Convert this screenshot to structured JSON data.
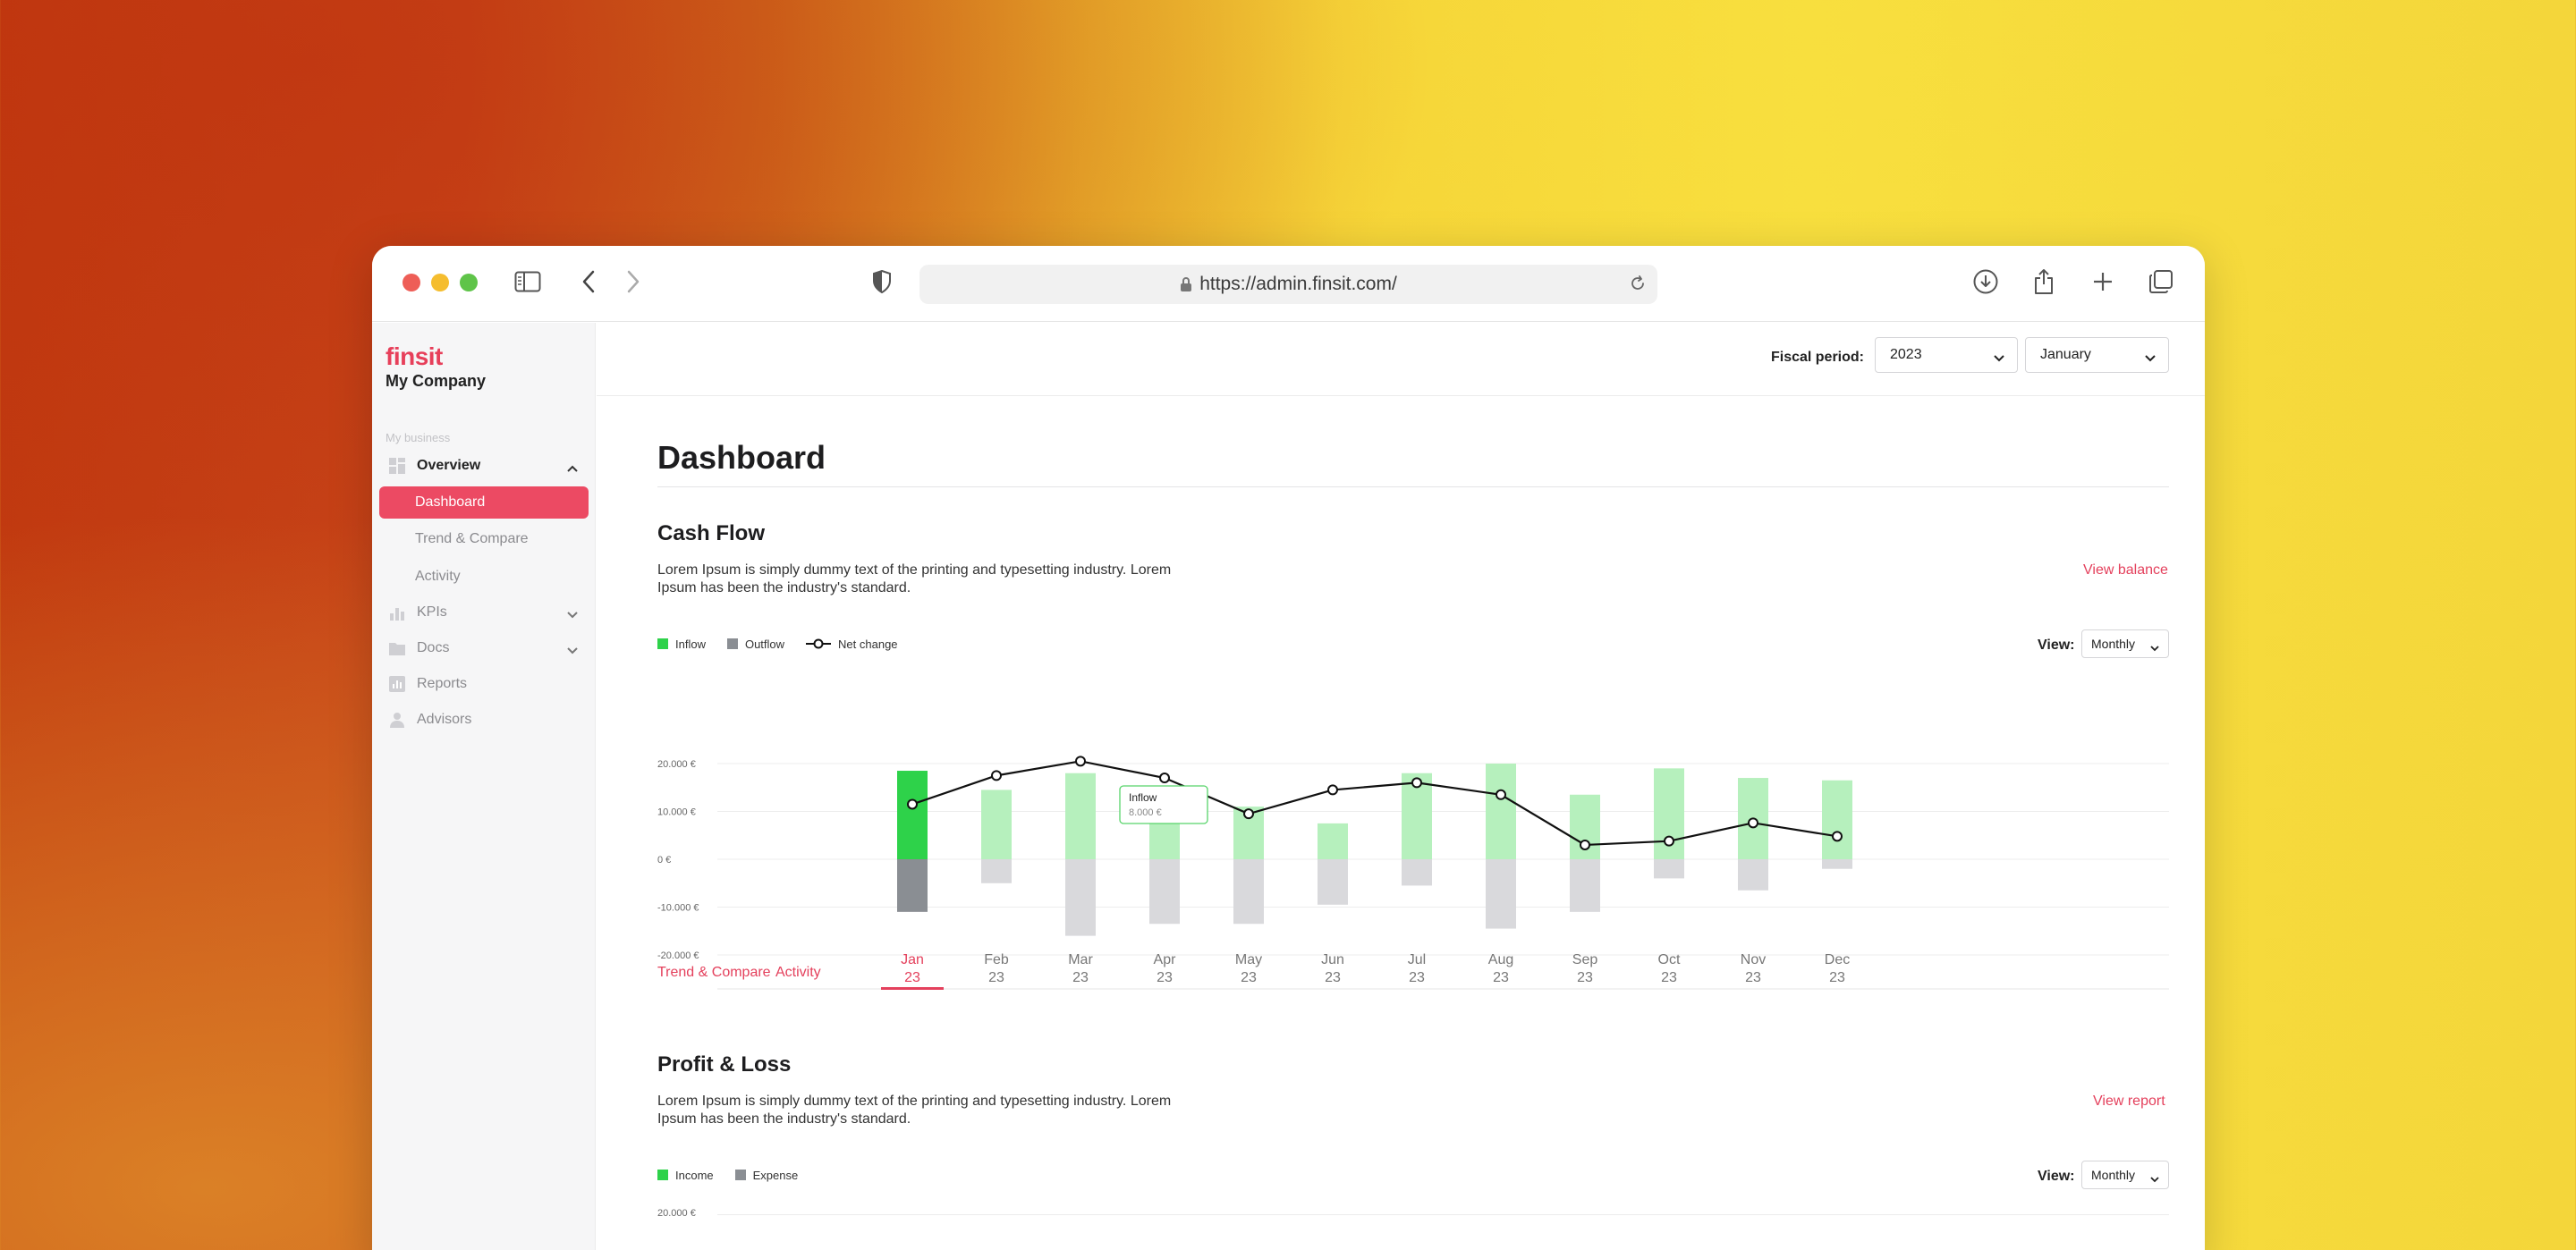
{
  "browser": {
    "url": "https://admin.finsit.com/"
  },
  "sidebar": {
    "logo": "finsit",
    "company": "My Company",
    "section_label": "My business",
    "items": [
      {
        "label": "Overview",
        "icon": "grid-icon"
      },
      {
        "label": "Dashboard"
      },
      {
        "label": "Trend & Compare"
      },
      {
        "label": "Activity"
      },
      {
        "label": "KPIs",
        "icon": "bar-chart-icon"
      },
      {
        "label": "Docs",
        "icon": "folder-icon"
      },
      {
        "label": "Reports",
        "icon": "report-icon"
      },
      {
        "label": "Advisors",
        "icon": "advisor-icon"
      }
    ]
  },
  "topbar": {
    "fiscal_label": "Fiscal period:",
    "year": "2023",
    "month": "January"
  },
  "page_title": "Dashboard",
  "cashflow": {
    "title": "Cash Flow",
    "description": "Lorem Ipsum is simply dummy text of the printing and typesetting industry. Lorem Ipsum has been the industry's standard.",
    "link": "View balance",
    "view_label": "View:",
    "view_value": "Monthly",
    "tooltip_title": "Inflow",
    "tooltip_value": "8.000 €",
    "footer_links": [
      "Trend & Compare",
      "Activity"
    ]
  },
  "profit_loss": {
    "title": "Profit & Loss",
    "description": "Lorem Ipsum is simply dummy text of the printing and typesetting industry. Lorem Ipsum has been the industry's standard.",
    "link": "View report",
    "view_label": "View:",
    "view_value": "Monthly",
    "legend": [
      "Income",
      "Expense"
    ],
    "y_tick_top": "20.000 €"
  },
  "colors": {
    "accent": "#e4405c",
    "inflow_selected": "#2ed24a",
    "inflow": "#b6f0bd",
    "outflow_selected": "#8a8e93",
    "outflow": "#d9d9dc",
    "net_line": "#111111"
  },
  "chart_data": {
    "type": "bar",
    "title": "",
    "legend": [
      "Inflow",
      "Outflow",
      "Net change"
    ],
    "categories": [
      "Jan",
      "Feb",
      "Mar",
      "Apr",
      "May",
      "Jun",
      "Jul",
      "Aug",
      "Sep",
      "Oct",
      "Nov",
      "Dec"
    ],
    "category_sub": [
      "23",
      "23",
      "23",
      "23",
      "23",
      "23",
      "23",
      "23",
      "23",
      "23",
      "23",
      "23"
    ],
    "selected_index": 0,
    "y_ticks": [
      "20.000 €",
      "10.000 €",
      "0 €",
      "-10.000 €",
      "-20.000 €"
    ],
    "ylim": [
      -20000,
      20000
    ],
    "series": [
      {
        "name": "Inflow",
        "values": [
          18500,
          14500,
          18000,
          8000,
          11000,
          7500,
          18000,
          20000,
          13500,
          19000,
          17000,
          16500
        ]
      },
      {
        "name": "Outflow",
        "values": [
          -11000,
          -5000,
          -16000,
          -13500,
          -13500,
          -9500,
          -5500,
          -14500,
          -11000,
          -4000,
          -6500,
          -2000
        ]
      },
      {
        "name": "Net change",
        "values": [
          11500,
          17500,
          20500,
          17000,
          9500,
          14500,
          16000,
          13500,
          3000,
          3800,
          7600,
          4800
        ]
      }
    ]
  }
}
